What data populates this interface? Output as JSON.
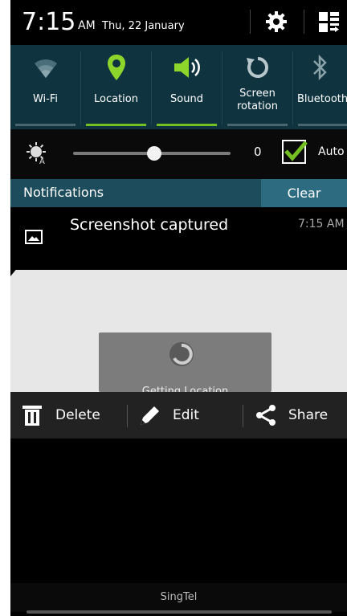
{
  "status": {
    "time": "7:15",
    "ampm": "AM",
    "date": "Thu, 22 January"
  },
  "quick_settings": [
    {
      "label": "Wi-Fi",
      "icon": "wifi-icon",
      "active": false
    },
    {
      "label": "Location",
      "icon": "location-icon",
      "active": true
    },
    {
      "label": "Sound",
      "icon": "sound-icon",
      "active": true
    },
    {
      "label": "Screen\nrotation",
      "icon": "rotation-icon",
      "active": false
    },
    {
      "label": "Bluetooth",
      "icon": "bluetooth-icon",
      "active": false
    }
  ],
  "brightness": {
    "value": "0",
    "auto_label": "Auto",
    "auto_checked": true
  },
  "notifications": {
    "title": "Notifications",
    "clear_label": "Clear",
    "items": [
      {
        "title": "Screenshot captured",
        "time": "7:15 AM"
      }
    ]
  },
  "preview": {
    "loading_text": "Getting Location"
  },
  "actions": {
    "delete": "Delete",
    "edit": "Edit",
    "share": "Share"
  },
  "footer": {
    "carrier": "SingTel"
  },
  "colors": {
    "accent_green": "#74c023",
    "qs_bg": "#0f3440",
    "notif_bar": "#1d4c5c"
  }
}
